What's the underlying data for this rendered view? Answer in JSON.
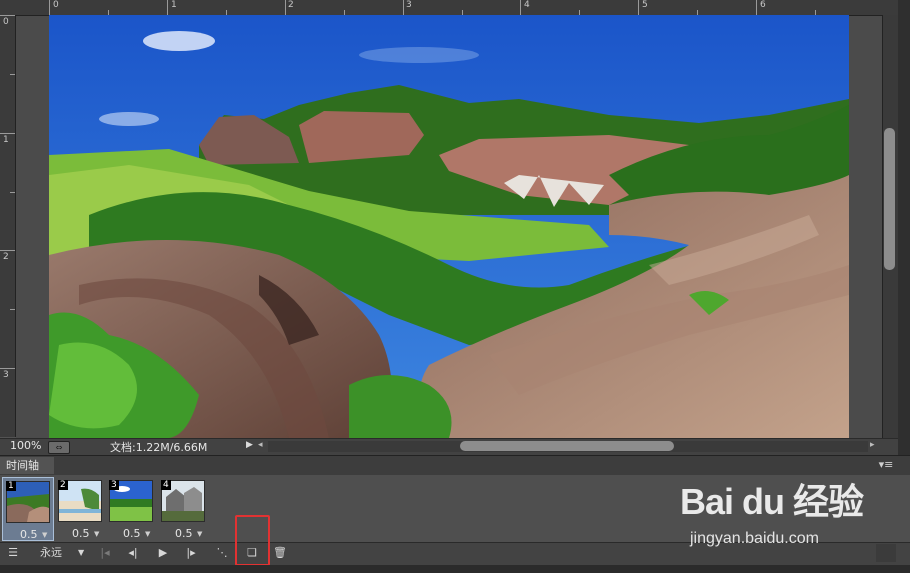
{
  "ruler": {
    "top_labels": [
      "0",
      "1",
      "2",
      "3",
      "4",
      "5",
      "6"
    ],
    "left_labels": [
      "0",
      "1",
      "2",
      "3"
    ]
  },
  "status": {
    "zoom": "100%",
    "doc_info": "文档:1.22M/6.66M"
  },
  "timeline": {
    "title": "时间轴",
    "loop_option": "永远",
    "frames": [
      {
        "number": "1",
        "delay": "0.5"
      },
      {
        "number": "2",
        "delay": "0.5"
      },
      {
        "number": "3",
        "delay": "0.5"
      },
      {
        "number": "4",
        "delay": "0.5"
      }
    ]
  },
  "watermark": {
    "logo_text": "Bai du 经验",
    "url": "jingyan.baidu.com"
  },
  "icons": {
    "convert": "convert-to-video-timeline-icon",
    "first": "first-frame-icon",
    "prev": "previous-frame-icon",
    "play": "play-icon",
    "next": "next-frame-icon",
    "tween": "tween-icon",
    "duplicate": "duplicate-frame-icon",
    "delete": "trash-icon"
  },
  "colors": {
    "selected_frame": "#6c7c92",
    "highlight": "#e23232",
    "panel": "#535353"
  }
}
